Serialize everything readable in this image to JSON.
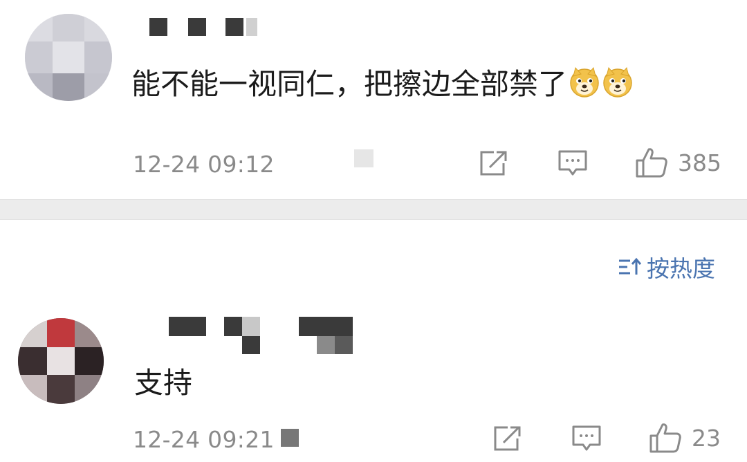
{
  "comments": [
    {
      "text": "能不能一视同仁，把擦边全部禁了",
      "emojis": [
        "doge-emoji",
        "doge-emoji"
      ],
      "time": "12-24 09:12",
      "likes": "385"
    },
    {
      "text": "支持",
      "time": "12-24 09:21",
      "likes": "23"
    }
  ],
  "sort": {
    "label": "按热度"
  },
  "colors": {
    "accent": "#4a74b0",
    "meta_text": "#8a8a8a",
    "divider": "#ececec"
  },
  "icons": [
    "share-icon",
    "comment-icon",
    "like-icon",
    "sort-icon",
    "doge-emoji"
  ]
}
